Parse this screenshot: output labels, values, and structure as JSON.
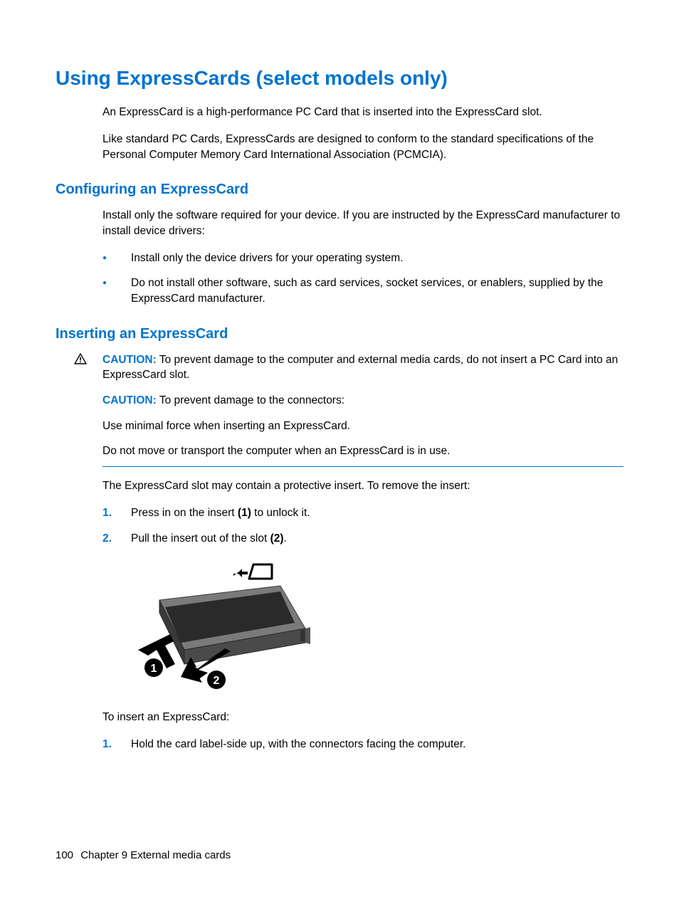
{
  "title": "Using ExpressCards (select models only)",
  "intro": {
    "p1": "An ExpressCard is a high-performance PC Card that is inserted into the ExpressCard slot.",
    "p2": "Like standard PC Cards, ExpressCards are designed to conform to the standard specifications of the Personal Computer Memory Card International Association (PCMCIA)."
  },
  "section_configure": {
    "heading": "Configuring an ExpressCard",
    "p1": "Install only the software required for your device. If you are instructed by the ExpressCard manufacturer to install device drivers:",
    "bullets": [
      "Install only the device drivers for your operating system.",
      "Do not install other software, such as card services, socket services, or enablers, supplied by the ExpressCard manufacturer."
    ]
  },
  "section_insert": {
    "heading": "Inserting an ExpressCard",
    "caution1_label": "CAUTION:",
    "caution1_text": "To prevent damage to the computer and external media cards, do not insert a PC Card into an ExpressCard slot.",
    "caution2_label": "CAUTION:",
    "caution2_text": "To prevent damage to the connectors:",
    "caution_line1": "Use minimal force when inserting an ExpressCard.",
    "caution_line2": "Do not move or transport the computer when an ExpressCard is in use.",
    "p_after": "The ExpressCard slot may contain a protective insert. To remove the insert:",
    "steps_remove": [
      {
        "num": "1.",
        "text_a": "Press in on the insert ",
        "bold": "(1)",
        "text_b": " to unlock it."
      },
      {
        "num": "2.",
        "text_a": "Pull the insert out of the slot ",
        "bold": "(2)",
        "text_b": "."
      }
    ],
    "p_insert_intro": "To insert an ExpressCard:",
    "steps_insert": [
      {
        "num": "1.",
        "text": "Hold the card label-side up, with the connectors facing the computer."
      }
    ]
  },
  "footer": {
    "page_num": "100",
    "chapter": "Chapter 9   External media cards"
  }
}
